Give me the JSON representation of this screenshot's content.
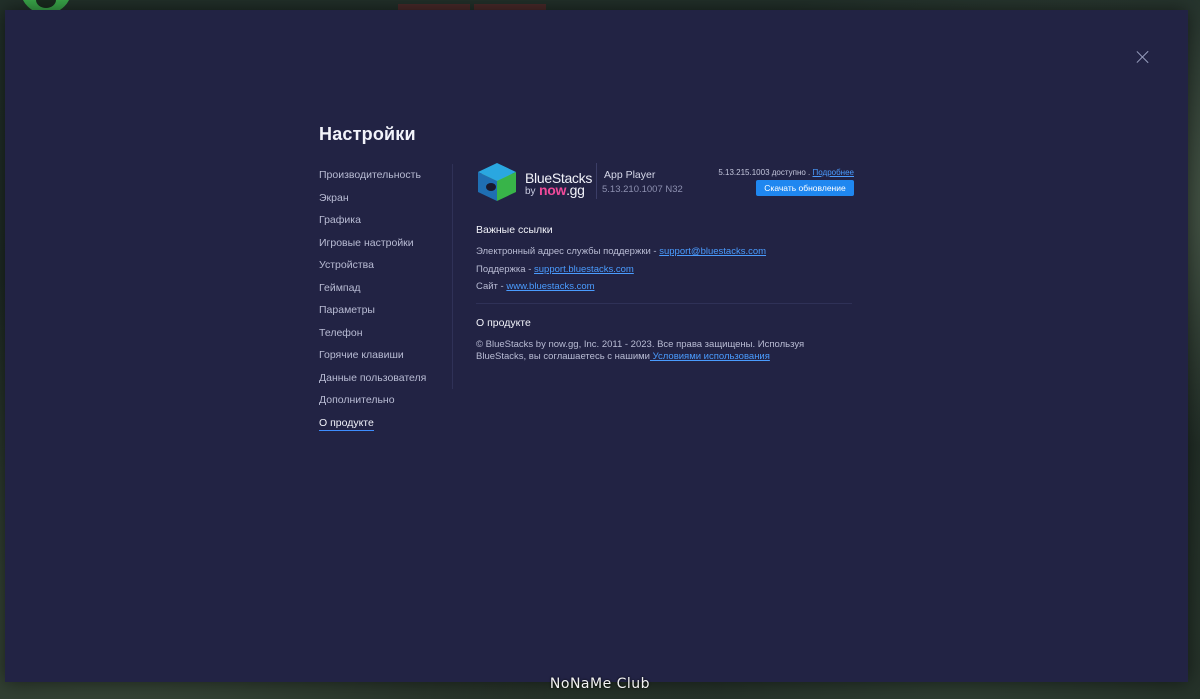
{
  "settings": {
    "title": "Настройки",
    "nav": [
      {
        "label": "Производительность"
      },
      {
        "label": "Экран"
      },
      {
        "label": "Графика"
      },
      {
        "label": "Игровые настройки"
      },
      {
        "label": "Устройства"
      },
      {
        "label": "Геймпад"
      },
      {
        "label": "Параметры"
      },
      {
        "label": "Телефон"
      },
      {
        "label": "Горячие клавиши"
      },
      {
        "label": "Данные пользователя"
      },
      {
        "label": "Дополнительно"
      },
      {
        "label": "О продукте",
        "active": true
      }
    ]
  },
  "product": {
    "brand_name": "BlueStacks",
    "brand_by": "by",
    "brand_now": "now",
    "brand_gg": ".gg",
    "app_title": "App Player",
    "version": "5.13.210.1007 N32",
    "update_available_text": "5.13.215.1003 доступно .",
    "update_more_link": "Подробнее",
    "update_button": "Скачать обновление"
  },
  "links": {
    "section_title": "Важные ссылки",
    "support_email_label": "Электронный адрес службы поддержки - ",
    "support_email": "support@bluestacks.com",
    "support_label": "Поддержка - ",
    "support_site": "support.bluestacks.com",
    "site_label": "Сайт - ",
    "site": "www.bluestacks.com"
  },
  "about": {
    "section_title": "О продукте",
    "copyright_line1": "© BlueStacks by now.gg, Inc. 2011 - 2023. Все права защищены. Используя",
    "copyright_line2": "BlueStacks, вы соглашаетесь с нашими",
    "terms_link": " Условиями использования"
  },
  "watermark": "NоNаMе Club",
  "colors": {
    "dialog_bg": "#222344",
    "accent": "#1f87f0",
    "link": "#4a9cff",
    "brand_pink": "#f04a9a"
  },
  "icons": {
    "close": "close-icon",
    "logo": "bluestacks-logo-icon"
  }
}
